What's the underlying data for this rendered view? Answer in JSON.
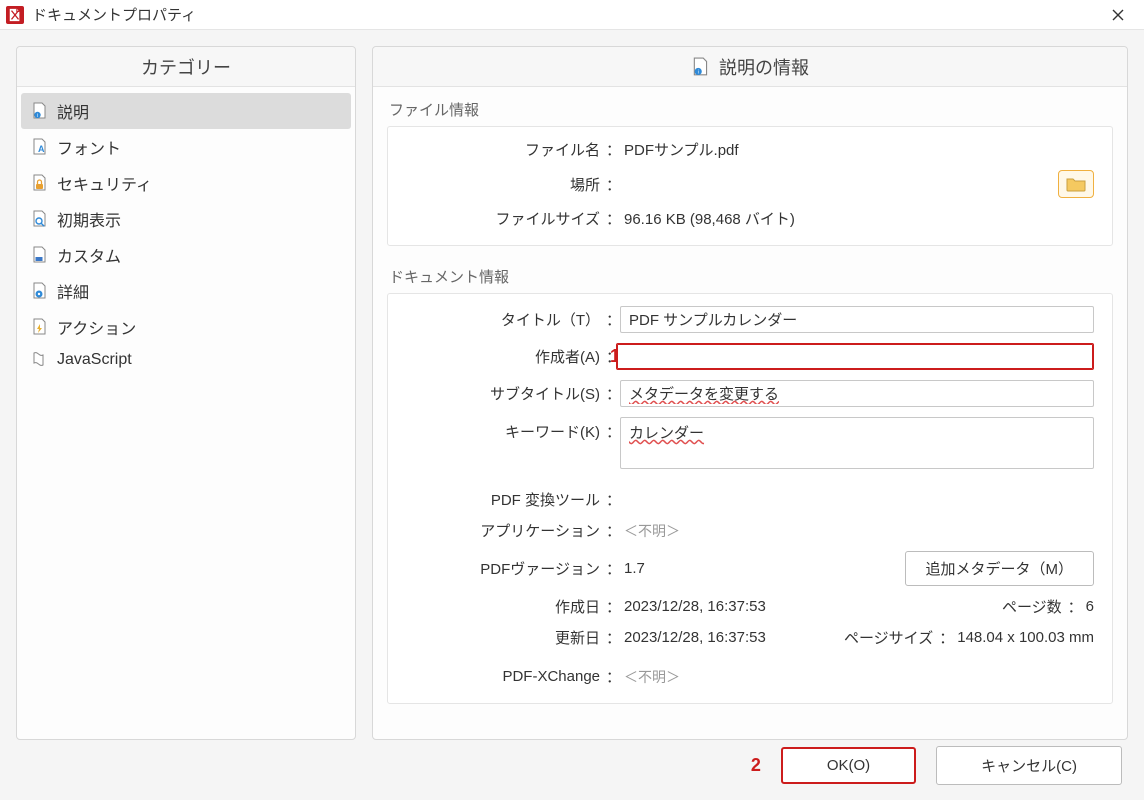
{
  "window": {
    "title": "ドキュメントプロパティ"
  },
  "sidebar": {
    "header": "カテゴリー",
    "items": [
      {
        "label": "説明"
      },
      {
        "label": "フォント"
      },
      {
        "label": "セキュリティ"
      },
      {
        "label": "初期表示"
      },
      {
        "label": "カスタム"
      },
      {
        "label": "詳細"
      },
      {
        "label": "アクション"
      },
      {
        "label": "JavaScript"
      }
    ]
  },
  "content": {
    "header": "説明の情報",
    "file_info": {
      "group_label": "ファイル情報",
      "filename_label": "ファイル名",
      "filename_value": "PDFサンプル.pdf",
      "location_label": "場所",
      "location_value": "",
      "size_label": "ファイルサイズ",
      "size_value": "96.16 KB (98,468 バイト)"
    },
    "doc_info": {
      "group_label": "ドキュメント情報",
      "title_label": "タイトル（T）",
      "title_value": "PDF サンプルカレンダー",
      "author_label": "作成者(A)",
      "author_value": "",
      "subtitle_label": "サブタイトル(S)",
      "subtitle_value": "メタデータを変更する",
      "keyword_label": "キーワード(K)",
      "keyword_value": "カレンダー",
      "converter_label": "PDF 変換ツール",
      "converter_value": "",
      "app_label": "アプリケーション",
      "app_value": "＜不明＞",
      "version_label": "PDFヴァージョン",
      "version_value": "1.7",
      "meta_button": "追加メタデータ（M）",
      "created_label": "作成日",
      "created_value": "2023/12/28, 16:37:53",
      "modified_label": "更新日",
      "modified_value": "2023/12/28, 16:37:53",
      "pages_label": "ページ数",
      "pages_value": "6",
      "pagesize_label": "ページサイズ",
      "pagesize_value": "148.04 x 100.03 mm",
      "xchange_label": "PDF-XChange",
      "xchange_value": "＜不明＞"
    }
  },
  "annotations": {
    "a1": "1",
    "a2": "2"
  },
  "footer": {
    "ok": "OK(O)",
    "cancel": "キャンセル(C)"
  }
}
